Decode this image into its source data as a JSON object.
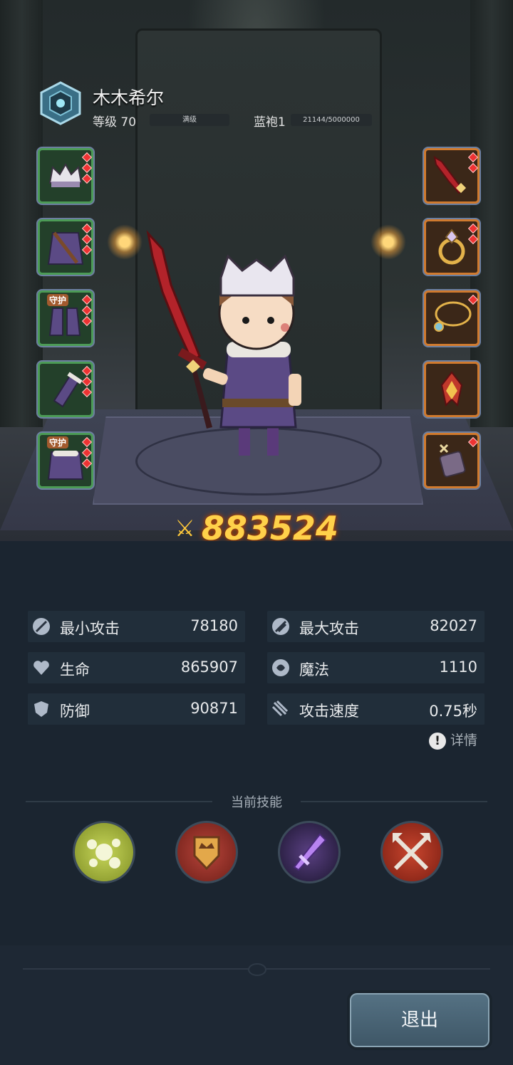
{
  "character": {
    "name": "木木希尔",
    "level_label": "等级 70",
    "level_status": "满级",
    "rank_label": "蓝袍1",
    "rank_progress": "21144/5000000",
    "class_icon": "class-emblem-icon"
  },
  "equipment": {
    "left": [
      {
        "name": "helmet-slot",
        "icon": "horned-helmet-icon",
        "tag": ""
      },
      {
        "name": "armor-slot",
        "icon": "robe-armor-icon",
        "tag": ""
      },
      {
        "name": "boots-slot",
        "icon": "boots-icon",
        "tag": "守护"
      },
      {
        "name": "gloves-slot",
        "icon": "bracer-icon",
        "tag": ""
      },
      {
        "name": "cloak-slot",
        "icon": "cloak-icon",
        "tag": "守护"
      }
    ],
    "right": [
      {
        "name": "weapon-slot",
        "icon": "red-greatsword-icon"
      },
      {
        "name": "ring-slot",
        "icon": "gold-ring-icon"
      },
      {
        "name": "necklace-slot",
        "icon": "gold-necklace-icon"
      },
      {
        "name": "belt-slot",
        "icon": "flame-emblem-icon"
      },
      {
        "name": "charm-slot",
        "icon": "amulet-box-icon"
      }
    ]
  },
  "combat_power": "883524",
  "stats": [
    {
      "label": "最小攻击",
      "value": "78180",
      "icon": "min-attack-icon"
    },
    {
      "label": "最大攻击",
      "value": "82027",
      "icon": "max-attack-icon"
    },
    {
      "label": "生命",
      "value": "865907",
      "icon": "heart-icon"
    },
    {
      "label": "魔法",
      "value": "1110",
      "icon": "magic-icon"
    },
    {
      "label": "防御",
      "value": "90871",
      "icon": "shield-icon"
    },
    {
      "label": "攻击速度",
      "value": "0.75秒",
      "icon": "attack-speed-icon"
    }
  ],
  "details_label": "详情",
  "skills_title": "当前技能",
  "skills": [
    {
      "icon": "poison-bubbles-icon",
      "color": "#9fb03a"
    },
    {
      "icon": "crown-shield-icon",
      "color": "#9c2f24"
    },
    {
      "icon": "purple-blade-icon",
      "color": "#3b2a55"
    },
    {
      "icon": "crossed-axes-icon",
      "color": "#a8321e"
    }
  ],
  "exit_label": "退出",
  "colors": {
    "background": "#1b2530",
    "power_gold": "#ffd14a",
    "green_frame": "#4c9b56",
    "orange_frame": "#d07a2e"
  }
}
